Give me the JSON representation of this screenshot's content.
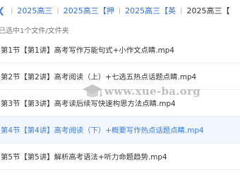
{
  "breadcrumb": {
    "items": [
      {
        "label": "2025高三"
      },
      {
        "label": "2025高三【押"
      },
      {
        "label": "2025高三【英"
      },
      {
        "label": "2025高三【"
      }
    ],
    "separator": "|"
  },
  "selection": {
    "status": "已选中1个文件/文件夹"
  },
  "files": [
    {
      "name": "第1节【第1讲】高考写作万能句式+小作文点睛.mp4"
    },
    {
      "name": "第2节【第2讲】高考阅读（上）+七选五热点话题点睛.mp4"
    },
    {
      "name": "第3节【第3讲】高考读后续写快速构思方法点睛.mp4"
    },
    {
      "name": "第4节【第4讲】高考阅读（下）+概要写作热点话题点睛.mp4",
      "selected": true
    },
    {
      "name": "第5节【第5讲】解析高考语法+听力命题趋势.mp4"
    }
  ],
  "watermark": {
    "text": "www.xue-ba.org",
    "icon": "graduation-cap-icon"
  },
  "colors": {
    "link": "#2f6fd6",
    "highlight_bg": "#f2f7ff",
    "highlight_text": "#3b7ddd"
  }
}
